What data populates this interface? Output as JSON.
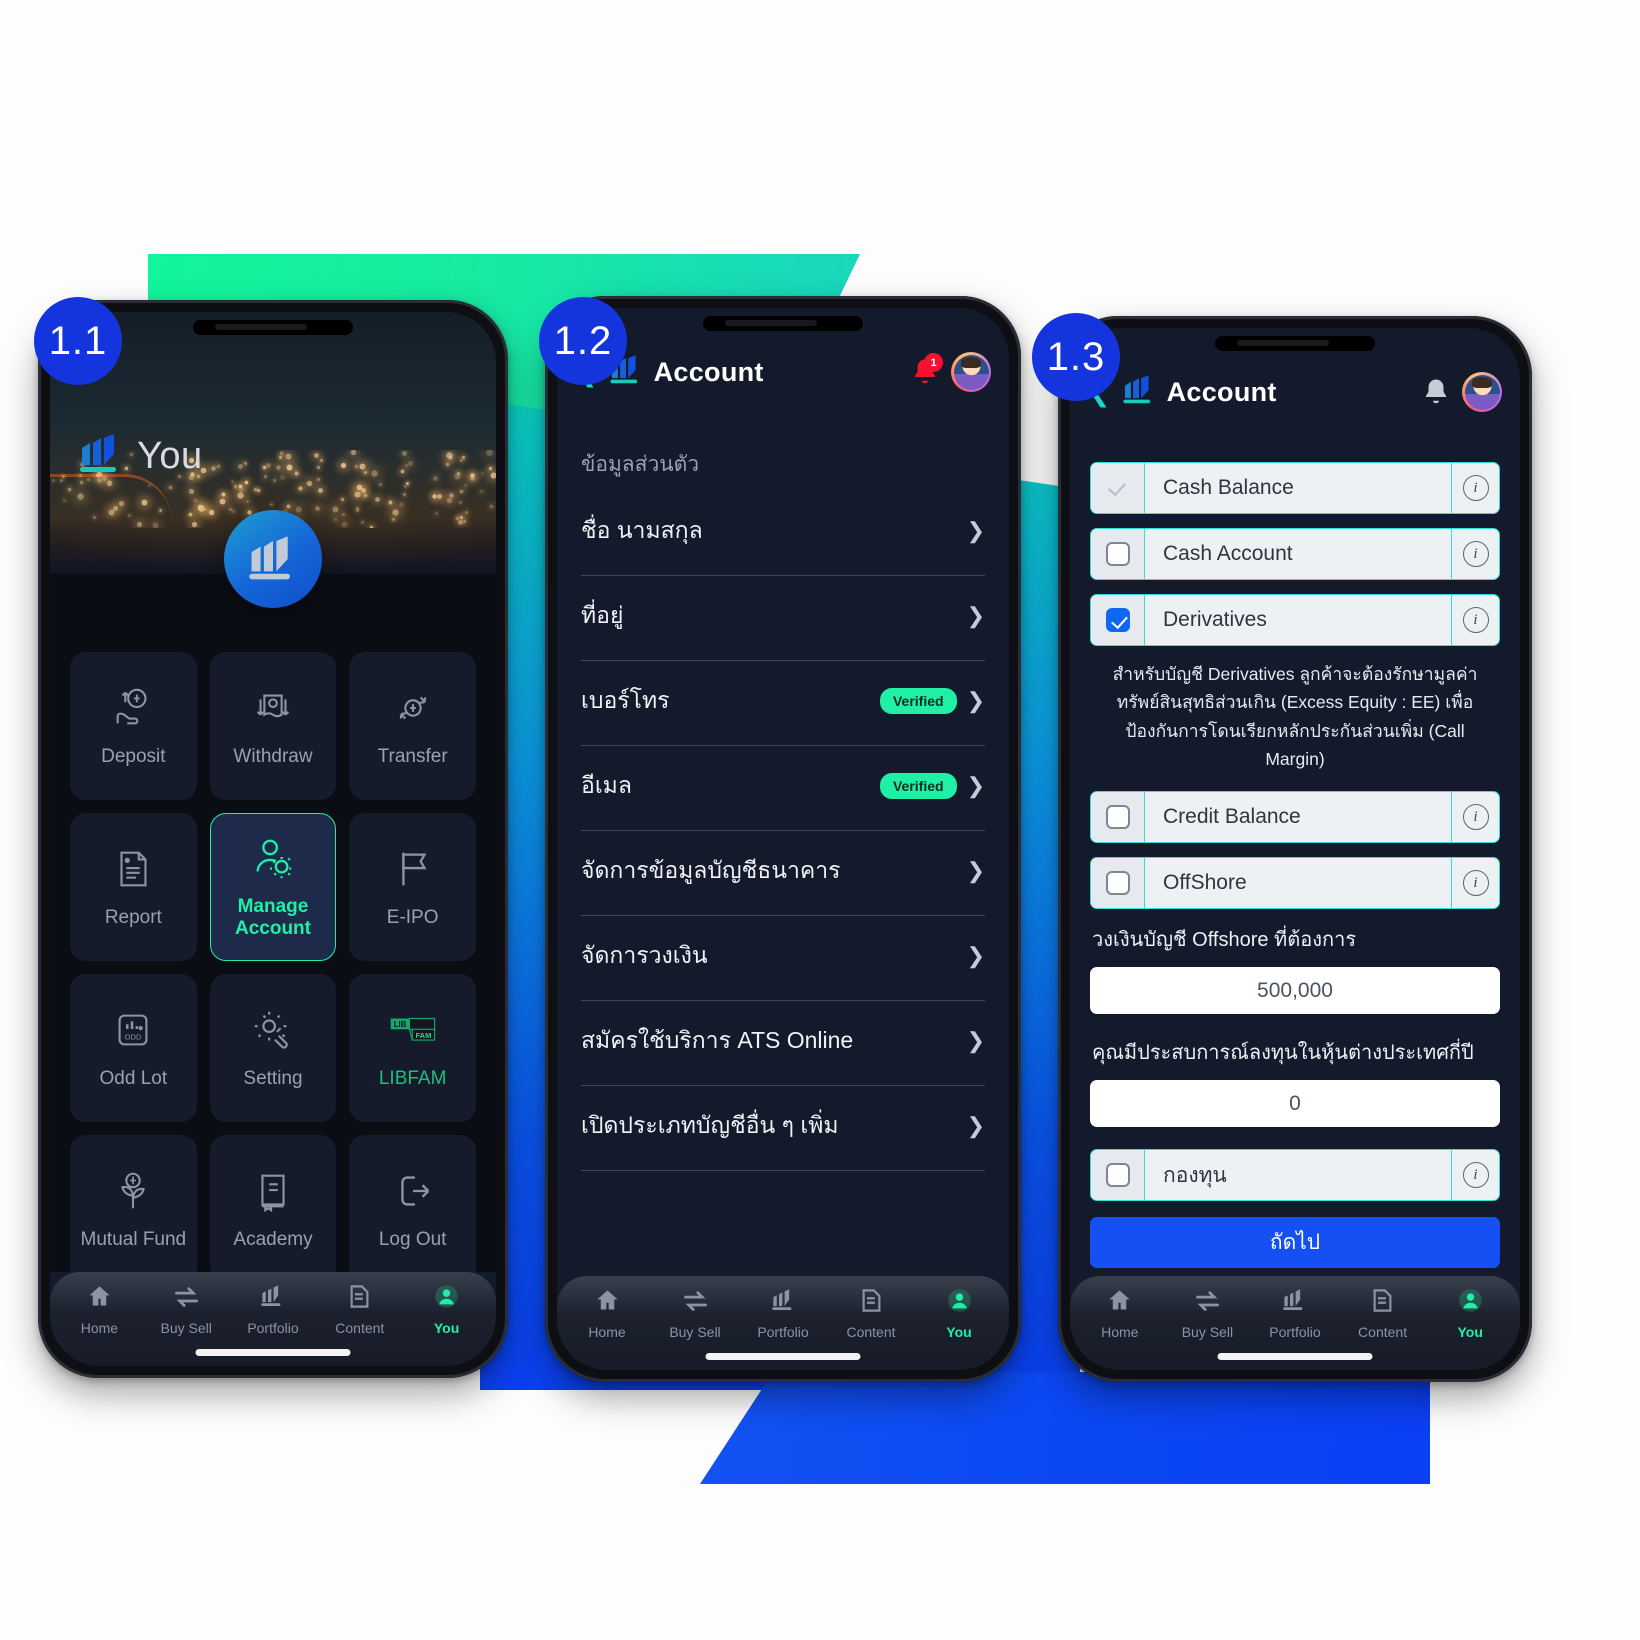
{
  "badges": {
    "step1": "1.1",
    "step2": "1.2",
    "step3": "1.3"
  },
  "colors": {
    "accent_green": "#1FF0A6",
    "accent_blue": "#1550F5",
    "badge_blue": "#1435DE",
    "screen_bg": "#131A2B",
    "cyan": "#31E0D8"
  },
  "screen1": {
    "hero_word": "You",
    "logo_icon": "bar-chart-logo-icon",
    "tiles": [
      {
        "label": "Deposit",
        "icon": "deposit-coin-hand-icon"
      },
      {
        "label": "Withdraw",
        "icon": "withdraw-banknote-icon"
      },
      {
        "label": "Transfer",
        "icon": "transfer-coin-arrows-icon"
      },
      {
        "label": "Report",
        "icon": "report-document-icon"
      },
      {
        "label": "Manage\nAccount",
        "icon": "manage-account-user-gear-icon",
        "selected": true
      },
      {
        "label": "E-IPO",
        "icon": "flag-icon"
      },
      {
        "label": "Odd Lot",
        "icon": "odd-lot-chart-icon"
      },
      {
        "label": "Setting",
        "icon": "gear-wrench-icon"
      },
      {
        "label": "LIBFAM",
        "icon": "libfam-box-icon",
        "brand": true
      },
      {
        "label": "Mutual Fund",
        "icon": "mutual-fund-sprout-icon"
      },
      {
        "label": "Academy",
        "icon": "academy-book-icon"
      },
      {
        "label": "Log Out",
        "icon": "logout-arrow-icon"
      },
      {
        "label": "",
        "icon": "shield-a-icon"
      },
      {
        "label": "",
        "icon": "headset-icon"
      }
    ],
    "nav": [
      {
        "label": "Home",
        "icon": "home-icon",
        "active": false
      },
      {
        "label": "Buy Sell",
        "icon": "buysell-icon",
        "active": false
      },
      {
        "label": "Portfolio",
        "icon": "portfolio-icon",
        "active": false
      },
      {
        "label": "Content",
        "icon": "content-icon",
        "active": false
      },
      {
        "label": "You",
        "icon": "you-icon",
        "active": true
      }
    ]
  },
  "screen2": {
    "title": "Account",
    "notification_count": "1",
    "section_label": "ข้อมูลส่วนตัว",
    "rows": [
      {
        "label": "ชื่อ นามสกุล",
        "chip": ""
      },
      {
        "label": "ที่อยู่",
        "chip": ""
      },
      {
        "label": "เบอร์โทร",
        "chip": "Verified"
      },
      {
        "label": "อีเมล",
        "chip": "Verified"
      },
      {
        "label": "จัดการข้อมูลบัญชีธนาคาร",
        "chip": ""
      },
      {
        "label": "จัดการวงเงิน",
        "chip": ""
      },
      {
        "label": "สมัครใช้บริการ ATS Online",
        "chip": ""
      },
      {
        "label": "เปิดประเภทบัญชีอื่น ๆ เพิ่ม",
        "chip": ""
      }
    ],
    "nav": [
      {
        "label": "Home",
        "icon": "home-icon",
        "active": false
      },
      {
        "label": "Buy Sell",
        "icon": "buysell-icon",
        "active": false
      },
      {
        "label": "Portfolio",
        "icon": "portfolio-icon",
        "active": false
      },
      {
        "label": "Content",
        "icon": "content-icon",
        "active": false
      },
      {
        "label": "You",
        "icon": "you-icon",
        "active": true
      }
    ]
  },
  "screen3": {
    "title": "Account",
    "checkboxes_top": [
      {
        "label": "Cash Balance",
        "state": "tick"
      },
      {
        "label": "Cash Account",
        "state": "unchecked"
      },
      {
        "label": "Derivatives",
        "state": "checked"
      }
    ],
    "derivatives_note": "สำหรับบัญชี Derivatives ลูกค้าจะต้องรักษามูลค่า ทรัพย์สินสุทธิส่วนเกิน (Excess Equity : EE) เพื่อป้องกันการโดนเรียกหลักประกันส่วนเพิ่ม (Call Margin)",
    "checkboxes_mid": [
      {
        "label": "Credit Balance",
        "state": "unchecked"
      },
      {
        "label": "OffShore",
        "state": "unchecked"
      }
    ],
    "offshore_label": "วงเงินบัญชี Offshore ที่ต้องการ",
    "offshore_value": "500,000",
    "experience_label": "คุณมีประสบการณ์ลงทุนในหุ้นต่างประเทศกี่ปี",
    "experience_value": "0",
    "fund_checkbox": {
      "label": "กองทุน",
      "state": "unchecked"
    },
    "cta_label": "ถัดไป",
    "nav": [
      {
        "label": "Home",
        "icon": "home-icon",
        "active": false
      },
      {
        "label": "Buy Sell",
        "icon": "buysell-icon",
        "active": false
      },
      {
        "label": "Portfolio",
        "icon": "portfolio-icon",
        "active": false
      },
      {
        "label": "Content",
        "icon": "content-icon",
        "active": false
      },
      {
        "label": "You",
        "icon": "you-icon",
        "active": true
      }
    ]
  }
}
